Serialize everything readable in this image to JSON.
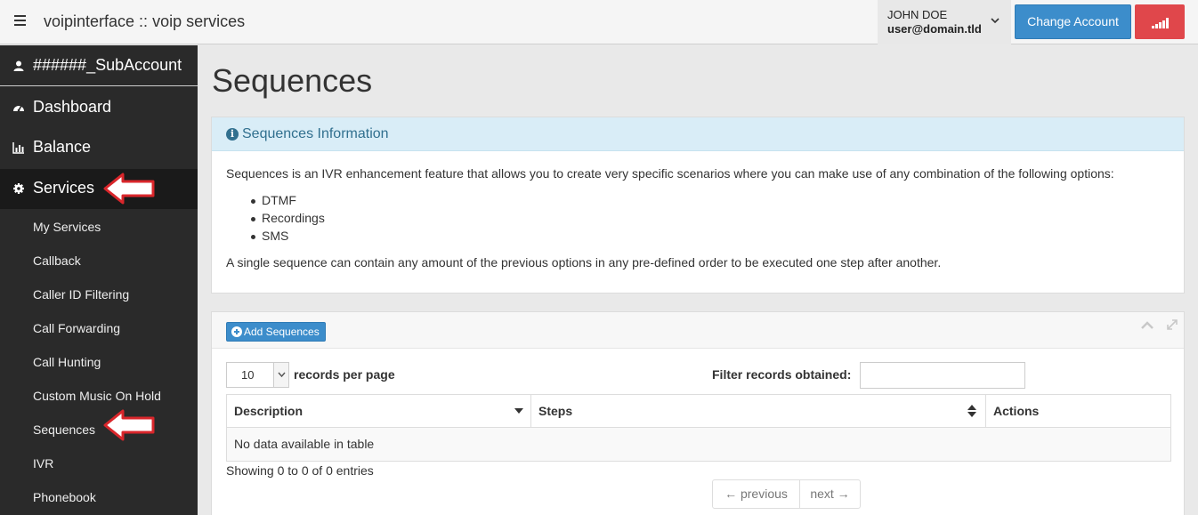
{
  "topbar": {
    "menu_icon": "hamburger-icon",
    "title": "voipinterface :: voip services",
    "user_name": "JOHN DOE",
    "user_email": "user@domain.tld",
    "change_account_label": "Change Account",
    "signal_icon": "signal-bars-icon",
    "accent_color": "#3c8dcb",
    "signal_color": "#e0474b"
  },
  "sidebar": {
    "account": "######_SubAccount",
    "main_items": [
      {
        "label": "Dashboard",
        "icon": "dashboard-icon"
      },
      {
        "label": "Balance",
        "icon": "bar-chart-icon"
      },
      {
        "label": "Services",
        "icon": "gear-icon",
        "active": true
      }
    ],
    "sub_items": [
      {
        "label": "My Services"
      },
      {
        "label": "Callback"
      },
      {
        "label": "Caller ID Filtering"
      },
      {
        "label": "Call Forwarding"
      },
      {
        "label": "Call Hunting"
      },
      {
        "label": "Custom Music On Hold"
      },
      {
        "label": "Sequences",
        "active": true
      },
      {
        "label": "IVR"
      },
      {
        "label": "Phonebook"
      }
    ]
  },
  "main": {
    "page_title": "Sequences",
    "info_panel": {
      "title": "Sequences Information",
      "intro": "Sequences is an IVR enhancement feature that allows you to create very specific scenarios where you can make use of any combination of the following options:",
      "options": [
        "DTMF",
        "Recordings",
        "SMS"
      ],
      "outro": "A single sequence can contain any amount of the previous options in any pre-defined order to be executed one step after another."
    },
    "table_panel": {
      "add_button_label": "Add Sequences",
      "page_length_value": "10",
      "page_length_label": "records per page",
      "filter_label": "Filter records obtained:",
      "filter_value": "",
      "columns": [
        "Description",
        "Steps",
        "Actions"
      ],
      "empty_message": "No data available in table",
      "info_text": "Showing 0 to 0 of 0 entries",
      "prev_label": "← previous",
      "next_label": "next →"
    }
  }
}
